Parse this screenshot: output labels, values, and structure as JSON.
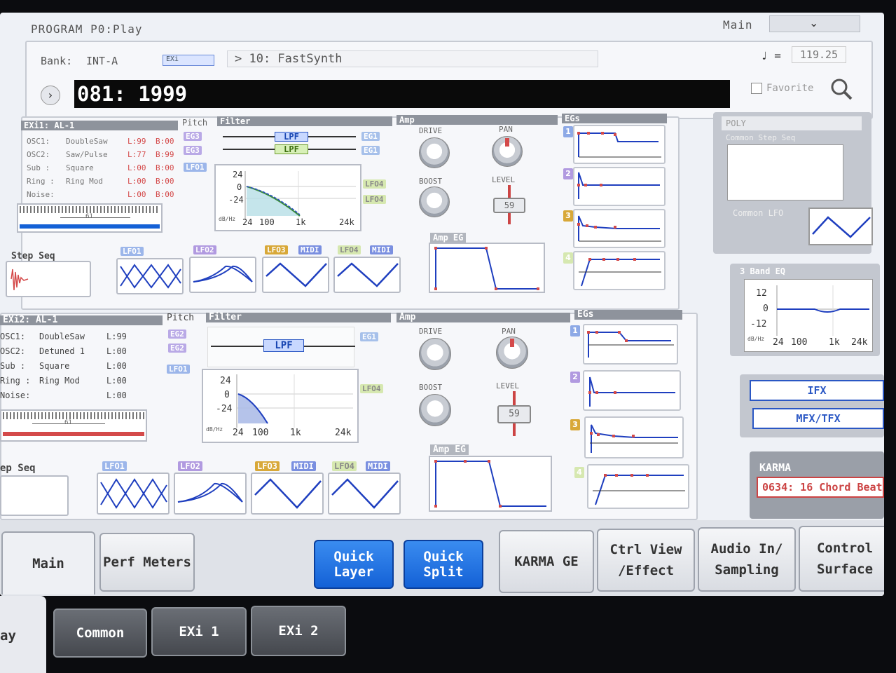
{
  "header": {
    "title": "PROGRAM P0:Play",
    "mode_label": "Main"
  },
  "bank": {
    "label": "Bank:",
    "value": "INT-A",
    "tag": "EXi",
    "category": "> 10: FastSynth"
  },
  "tempo": {
    "note_symbol": "♩ =",
    "value": "119.25"
  },
  "program": {
    "name": "081: 1999",
    "favorite_label": "Favorite"
  },
  "exi1": {
    "title": "EXi1: AL-1",
    "pitch": "Pitch",
    "filter": "Filter",
    "amp": "Amp",
    "egs": "EGs",
    "oscs": [
      {
        "name": "OSC1:",
        "type": "DoubleSaw",
        "l": "L:99",
        "b": "B:00"
      },
      {
        "name": "OSC2:",
        "type": "Saw/Pulse",
        "l": "L:77",
        "b": "B:99"
      },
      {
        "name": "Sub  :",
        "type": "Square",
        "l": "L:00",
        "b": "B:00"
      },
      {
        "name": "Ring :",
        "type": "Ring Mod",
        "l": "L:00",
        "b": "B:00"
      },
      {
        "name": "Noise:",
        "type": "",
        "l": "L:00",
        "b": "B:00"
      }
    ],
    "pitch_tags": [
      "EG3",
      "EG3",
      "LFO1"
    ],
    "filter_types": [
      "LPF",
      "LPF"
    ],
    "filter_out_tags": [
      "EG1",
      "EG1"
    ],
    "lfo_tags": [
      "LFO4",
      "LFO4"
    ],
    "range": "61",
    "graph": {
      "y_ticks": [
        "24",
        "0",
        "-24"
      ],
      "x_ticks": [
        "24",
        "100",
        "1k",
        "24k"
      ],
      "unit": "dB/Hz"
    },
    "drive": "DRIVE",
    "boost": "BOOST",
    "pan": "PAN",
    "level_label": "LEVEL",
    "level": "59",
    "amp_eg": "Amp EG",
    "step_seq": "Step Seq",
    "lfos": [
      "LFO1",
      "LFO2",
      "LFO3",
      "LFO4"
    ],
    "midi": "MIDI"
  },
  "exi2": {
    "title": "EXi2: AL-1",
    "pitch": "Pitch",
    "filter": "Filter",
    "amp": "Amp",
    "egs": "EGs",
    "oscs": [
      {
        "name": "OSC1:",
        "type": "DoubleSaw",
        "l": "L:99"
      },
      {
        "name": "OSC2:",
        "type": "Detuned 1",
        "l": "L:00"
      },
      {
        "name": "Sub  :",
        "type": "Square",
        "l": "L:00"
      },
      {
        "name": "Ring :",
        "type": "Ring Mod",
        "l": "L:00"
      },
      {
        "name": "Noise:",
        "type": "",
        "l": "L:00"
      }
    ],
    "pitch_tags": [
      "EG2",
      "EG2",
      "LFO1"
    ],
    "filter_types": [
      "LPF"
    ],
    "filter_out_tags": [
      "EG1"
    ],
    "lfo_tags": [
      "LFO4"
    ],
    "range": "61",
    "graph": {
      "y_ticks": [
        "24",
        "0",
        "-24"
      ],
      "x_ticks": [
        "24",
        "100",
        "1k",
        "24k"
      ],
      "unit": "dB/Hz"
    },
    "drive": "DRIVE",
    "boost": "BOOST",
    "pan": "PAN",
    "level_label": "LEVEL",
    "level": "59",
    "amp_eg": "Amp EG",
    "step_seq": "ep Seq",
    "lfos": [
      "LFO1",
      "LFO2",
      "LFO3",
      "LFO4"
    ],
    "midi": "MIDI"
  },
  "side": {
    "poly": "POLY",
    "common_step_seq": "Common Step Seq",
    "common_lfo": "Common LFO",
    "eq_title": "3 Band EQ",
    "eq_graph": {
      "y_ticks": [
        "12",
        "0",
        "-12"
      ],
      "x_ticks": [
        "24",
        "100",
        "1k",
        "24k"
      ],
      "unit": "dB/Hz"
    },
    "ifx": "IFX",
    "mfx": "MFX/TFX",
    "karma_title": "KARMA",
    "karma_value": "0634: 16 Chord Beat"
  },
  "tabs": {
    "main": "Main",
    "perf": "Perf Meters",
    "quick_layer": "Quick Layer",
    "quick_split": "Quick Split",
    "karma_ge": "KARMA GE",
    "ctrl_view": "Ctrl View /Effect",
    "audio_in": "Audio In/ Sampling",
    "control_surface": "Control Surface"
  },
  "page_tabs": {
    "play": "ay",
    "common": "Common",
    "exi1": "EXi 1",
    "exi2": "EXi 2"
  },
  "colors": {
    "accent": "#1461d6",
    "red": "#d44a4a",
    "line": "#1f3fbf"
  }
}
